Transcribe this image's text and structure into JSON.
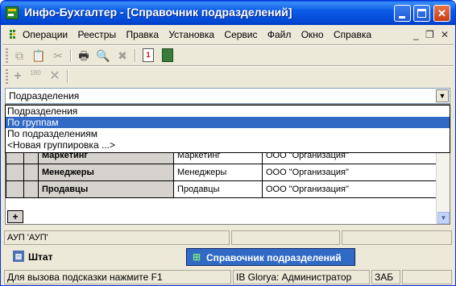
{
  "window": {
    "title": "Инфо-Бухгалтер - [Справочник подразделений]",
    "accent": "#0a5fe8",
    "close_color": "#c83d13"
  },
  "menubar": {
    "items": [
      "Операции",
      "Реестры",
      "Правка",
      "Установка",
      "Сервис",
      "Файл",
      "Окно",
      "Справка"
    ],
    "mdi_minimize": "_",
    "mdi_restore": "❐",
    "mdi_close": "✕"
  },
  "toolbar1": {
    "icons": [
      "copy-icon",
      "paste-icon",
      "cut-icon",
      "print-icon",
      "preview-icon",
      "delete-icon",
      "calendar-icon",
      "calculator-icon"
    ],
    "calendar_label": "1"
  },
  "toolbar2": {
    "icons": [
      "add-icon",
      "number-icon",
      "remove-icon"
    ],
    "number_label": "180"
  },
  "grouping": {
    "selected": "Подразделения",
    "options": [
      "Подразделения",
      "По группам",
      "По подразделениям",
      "<Новая группировка ...>"
    ],
    "highlighted_index": 1
  },
  "grid": {
    "rows": [
      {
        "name": "Маркетинг",
        "short": "Маркетинг",
        "org": "ООО \"Организация\""
      },
      {
        "name": "Менеджеры",
        "short": "Менеджеры",
        "org": "ООО \"Организация\""
      },
      {
        "name": "Продавцы",
        "short": "Продавцы",
        "org": "ООО \"Организация\""
      }
    ],
    "add_row": "+"
  },
  "info": {
    "left": "АУП 'АУП'"
  },
  "tasks": {
    "shtat": "Штат",
    "directory": "Справочник подразделений"
  },
  "status": {
    "hint": "Для вызова подсказки нажмите F1",
    "user": "IB Glorya: Администратор",
    "mode": "ЗАБ"
  }
}
